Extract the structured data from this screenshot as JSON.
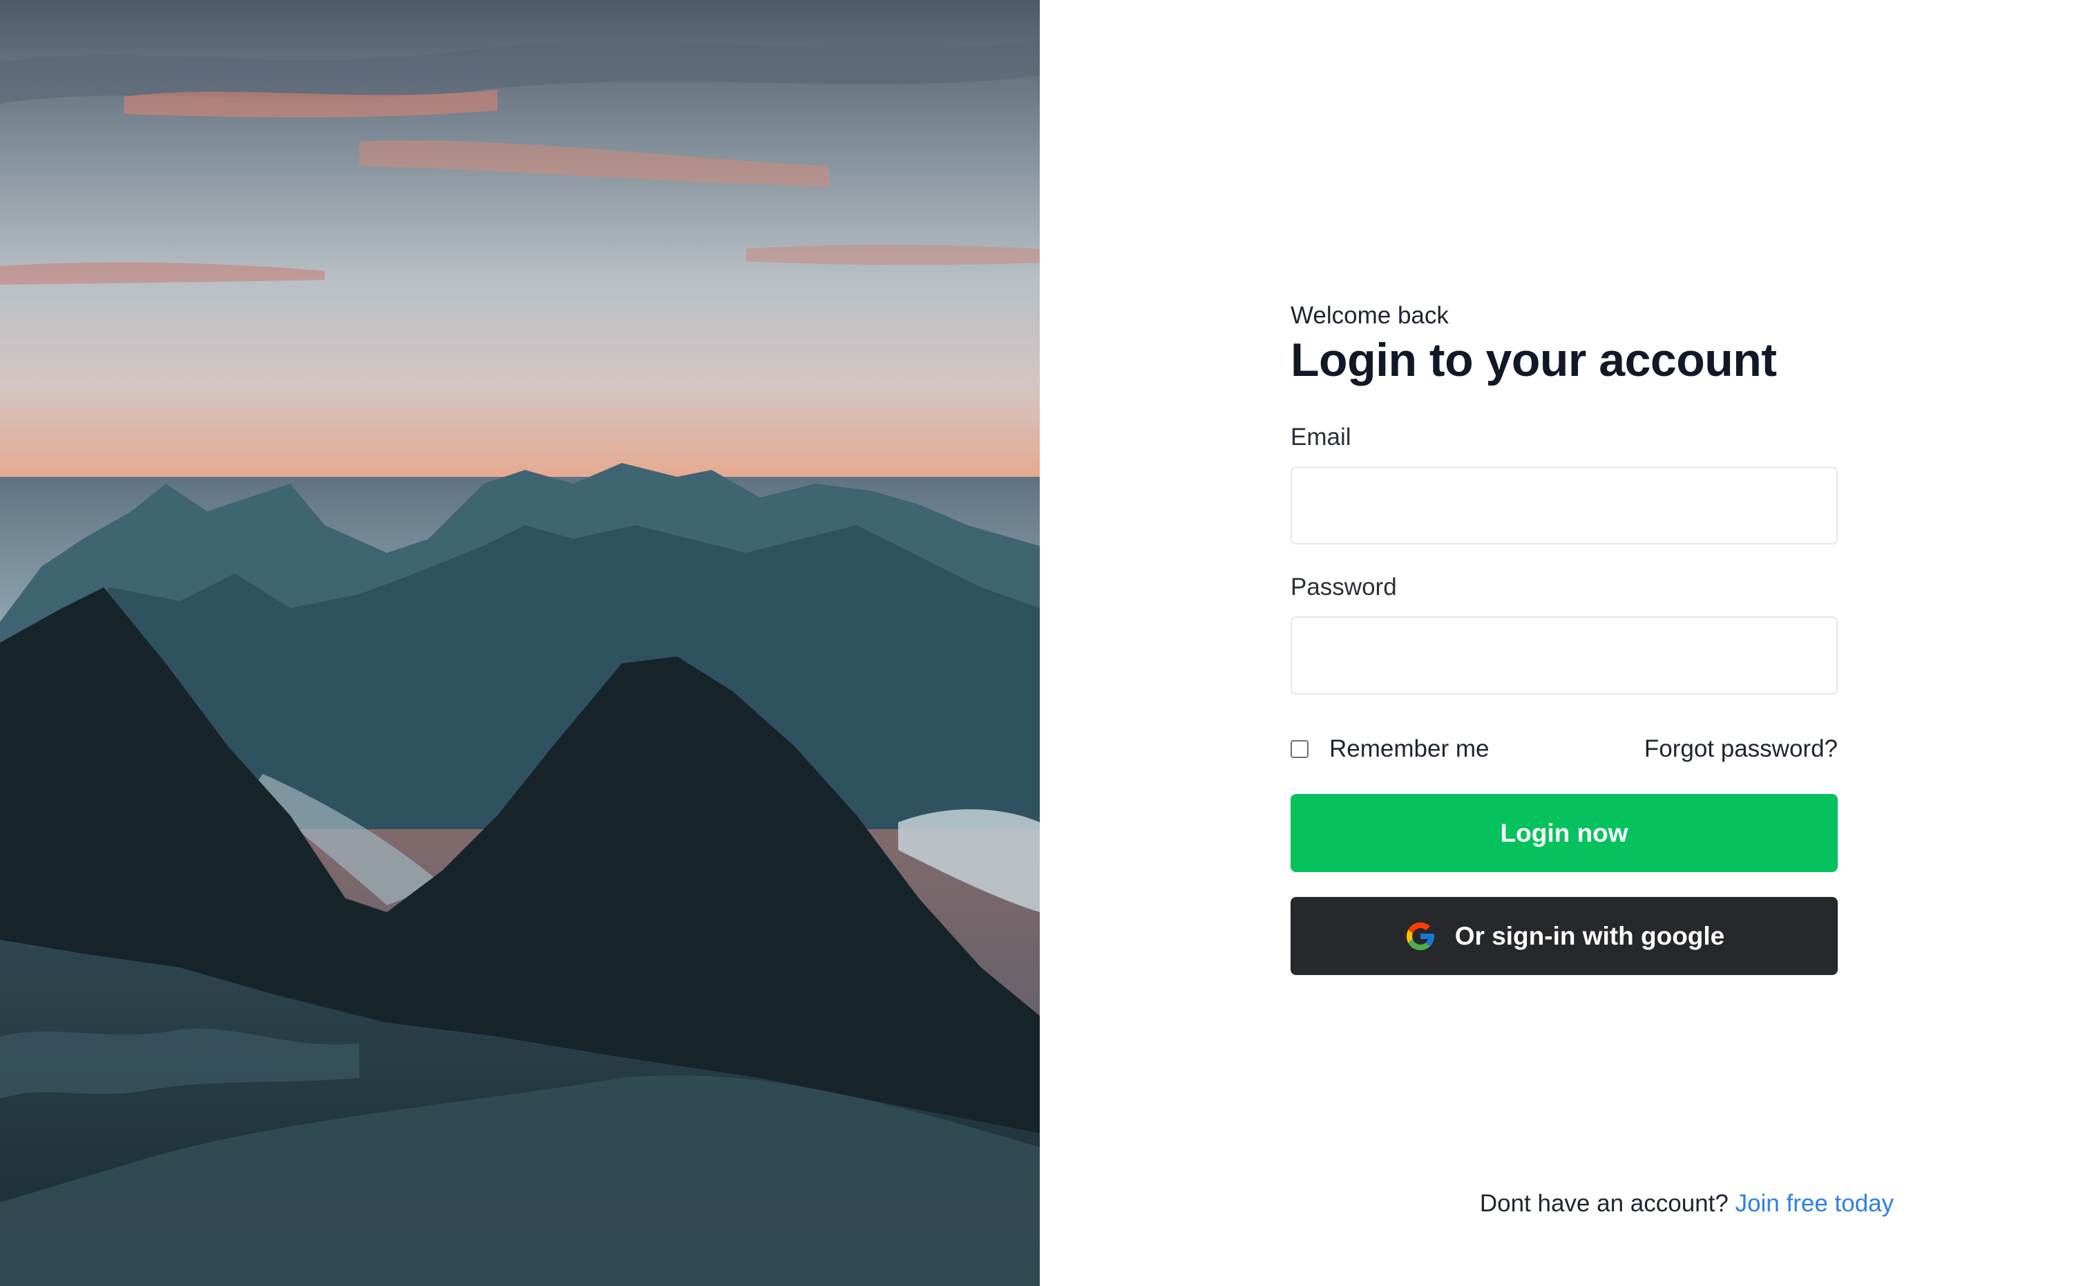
{
  "hero": {
    "image_description_icon": "mountain-sunset-image"
  },
  "form": {
    "eyebrow": "Welcome back",
    "title": "Login to your account",
    "email_label": "Email",
    "email_value": "",
    "password_label": "Password",
    "password_value": "",
    "remember_label": "Remember me",
    "remember_checked": false,
    "forgot_label": "Forgot password?",
    "login_button_label": "Login now",
    "google_button_label": "Or sign-in with google",
    "google_icon": "google-g-icon"
  },
  "footer": {
    "prompt": "Dont have an account?",
    "link_label": "Join free today"
  },
  "colors": {
    "primary_green": "#06c25e",
    "google_button_bg": "#27282c",
    "link_blue": "#2f7fe4",
    "title_text": "#111827"
  }
}
